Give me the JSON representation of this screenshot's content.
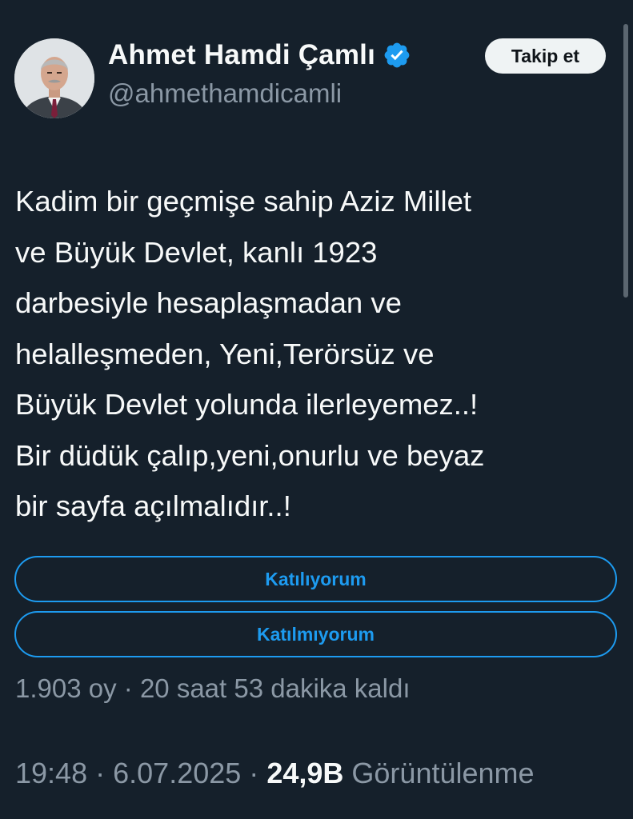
{
  "author": {
    "display_name": "Ahmet Hamdi Çamlı",
    "handle": "@ahmethamdicamli",
    "verified_icon": "verified-badge-icon",
    "avatar_icon": "avatar"
  },
  "follow_button": {
    "label": "Takip et"
  },
  "tweet": {
    "lines": [
      "Kadim bir geçmişe sahip Aziz Millet",
      "ve Büyük Devlet, kanlı 1923",
      "darbesiyle hesaplaşmadan ve",
      "helalleşmeden, Yeni,Terörsüz ve",
      "Büyük Devlet yolunda ilerleyemez..!",
      "Bir düdük çalıp,yeni,onurlu ve beyaz",
      "bir sayfa açılmalıdır..!"
    ]
  },
  "poll": {
    "options": [
      {
        "label": "Katılıyorum"
      },
      {
        "label": "Katılmıyorum"
      }
    ],
    "votes": "1.903 oy",
    "separator": "·",
    "time_left": "20 saat 53 dakika kaldı"
  },
  "footer": {
    "time": "19:48",
    "separator": "·",
    "date": "6.07.2025",
    "views_count": "24,9B",
    "views_label": "Görüntülenme"
  },
  "colors": {
    "background": "#15202b",
    "accent": "#1d9bf0",
    "text_primary": "#f7f9f9",
    "text_secondary": "#8b98a5"
  }
}
